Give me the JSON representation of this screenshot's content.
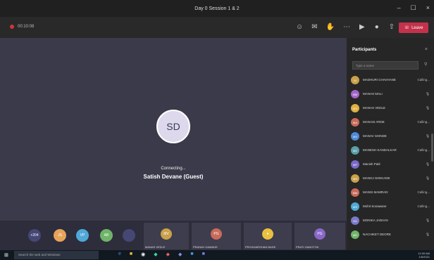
{
  "window": {
    "title": "Day 0 Session 1 & 2",
    "controls": [
      "–",
      "☐",
      "×"
    ]
  },
  "toolbar": {
    "record_label": "00:10:08",
    "leave_label": "Leave"
  },
  "stage": {
    "avatar_initials": "SD",
    "status": "Connecting...",
    "callee": "Satish Devane (Guest)"
  },
  "strip": {
    "mini": [
      {
        "label": "+204",
        "color": "#464775"
      },
      {
        "label": "JS",
        "color": "#e8a35a"
      },
      {
        "label": "VP",
        "color": "#4fa8d8"
      },
      {
        "label": "AB",
        "color": "#6fb468"
      },
      {
        "label": "",
        "color": "#464775"
      }
    ],
    "tiles": [
      {
        "initials": "MV",
        "name": "MANAS VEDLE",
        "color": "#c9a14a"
      },
      {
        "initials": "PG",
        "name": "PRANAV GAWADE",
        "color": "#c96a5a"
      },
      {
        "initials": "",
        "name": "PRIYADARSHAN BADE",
        "color": "#e9c040"
      },
      {
        "initials": "PG",
        "name": "PRATI GANGTOK",
        "color": "#8a68c8"
      }
    ]
  },
  "panel": {
    "title": "Participants",
    "search_placeholder": "Type a name",
    "participants": [
      {
        "initials": "M",
        "name": "MADHURI CHAVHANE",
        "status": "Calling...",
        "color": "#c9a14a"
      },
      {
        "initials": "MM",
        "name": "MANAS MALI",
        "status": "🎙",
        "color": "#a565c8"
      },
      {
        "initials": "MV",
        "name": "MANAS VEDLE",
        "status": "🎙",
        "color": "#e0b040"
      },
      {
        "initials": "MA",
        "name": "MANASI ARDE",
        "status": "Calling...",
        "color": "#c96a5a"
      },
      {
        "initials": "MS",
        "name": "MANAV SHINDE",
        "status": "🎙",
        "color": "#4f8ad8"
      },
      {
        "initials": "MK",
        "name": "MANESH KANDALKAR",
        "status": "Calling...",
        "color": "#5a9fa8"
      },
      {
        "initials": "MP",
        "name": "Manish Patil",
        "status": "🎙",
        "color": "#7a68c8"
      },
      {
        "initials": "MS",
        "name": "MANOJ SHEKADE",
        "status": "🎙",
        "color": "#c9a14a"
      },
      {
        "initials": "MM",
        "name": "MANSI MAMRAD",
        "status": "Calling...",
        "color": "#c96a5a"
      },
      {
        "initials": "MS",
        "name": "Mohit Sonawane",
        "status": "Calling...",
        "color": "#4fa8d8"
      },
      {
        "initials": "MJ",
        "name": "MONIKA JADHAV",
        "status": "🎙",
        "color": "#7a7ac8"
      },
      {
        "initials": "MD",
        "name": "NACHIKET DEORE",
        "status": "🎙",
        "color": "#6fb468"
      }
    ]
  },
  "taskbar": {
    "search_placeholder": "Search the web and Windows",
    "time": "11:59 AM",
    "date": "1/6/2021"
  }
}
